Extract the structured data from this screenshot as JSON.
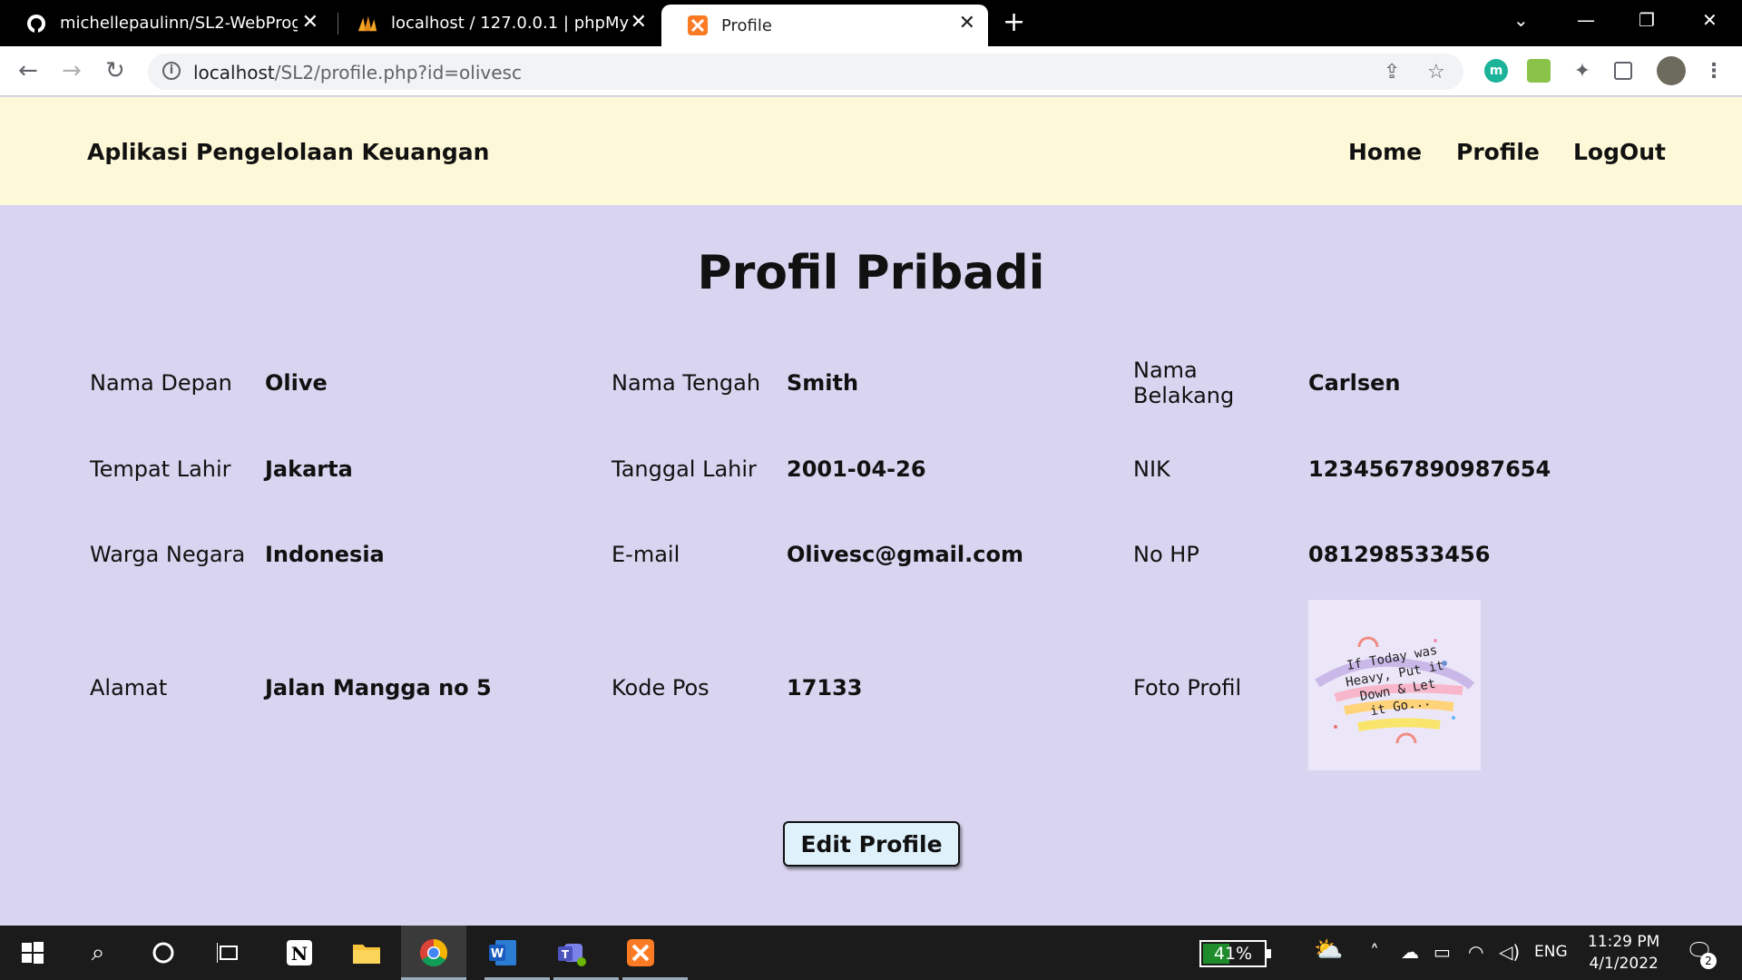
{
  "browser": {
    "tabs": [
      {
        "title": "michellepaulinn/SL2-WebProgram",
        "icon": "github-icon",
        "active": false
      },
      {
        "title": "localhost / 127.0.0.1 | phpMyAdmin",
        "icon": "phpmyadmin-icon",
        "active": false
      },
      {
        "title": "Profile",
        "icon": "xampp-icon",
        "active": true
      }
    ],
    "url_host": "localhost",
    "url_path": "/SL2/profile.php?id=olivesc"
  },
  "site": {
    "brand": "Aplikasi Pengelolaan Keuangan",
    "nav": [
      "Home",
      "Profile",
      "LogOut"
    ]
  },
  "page": {
    "title": "Profil Pribadi",
    "fields": {
      "nama_depan": {
        "label": "Nama Depan",
        "value": "Olive"
      },
      "nama_tengah": {
        "label": "Nama Tengah",
        "value": "Smith"
      },
      "nama_belakang": {
        "label": "Nama\nBelakang",
        "value": "Carlsen"
      },
      "tempat_lahir": {
        "label": "Tempat Lahir",
        "value": "Jakarta"
      },
      "tanggal_lahir": {
        "label": "Tanggal Lahir",
        "value": "2001-04-26"
      },
      "nik": {
        "label": "NIK",
        "value": "1234567890987654"
      },
      "warga_negara": {
        "label": "Warga Negara",
        "value": "Indonesia"
      },
      "email": {
        "label": "E-mail",
        "value": "Olivesc@gmail.com"
      },
      "no_hp": {
        "label": "No HP",
        "value": "081298533456"
      },
      "alamat": {
        "label": "Alamat",
        "value": "Jalan Mangga no 5"
      },
      "kode_pos": {
        "label": "Kode Pos",
        "value": "17133"
      },
      "foto_profil": {
        "label": "Foto Profil"
      }
    },
    "photo_text": [
      "If Today was",
      "Heavy, Put it",
      "Down & Let",
      "it Go..."
    ],
    "edit_button": "Edit Profile"
  },
  "taskbar": {
    "battery_text": "41%",
    "battery_level": 0.41,
    "language": "ENG",
    "time": "11:29 PM",
    "date": "4/1/2022",
    "notification_count": "2"
  },
  "colors": {
    "header_bg": "#fdf8d7",
    "content_bg": "#d9d4f0",
    "button_bg": "#dff1fb"
  }
}
